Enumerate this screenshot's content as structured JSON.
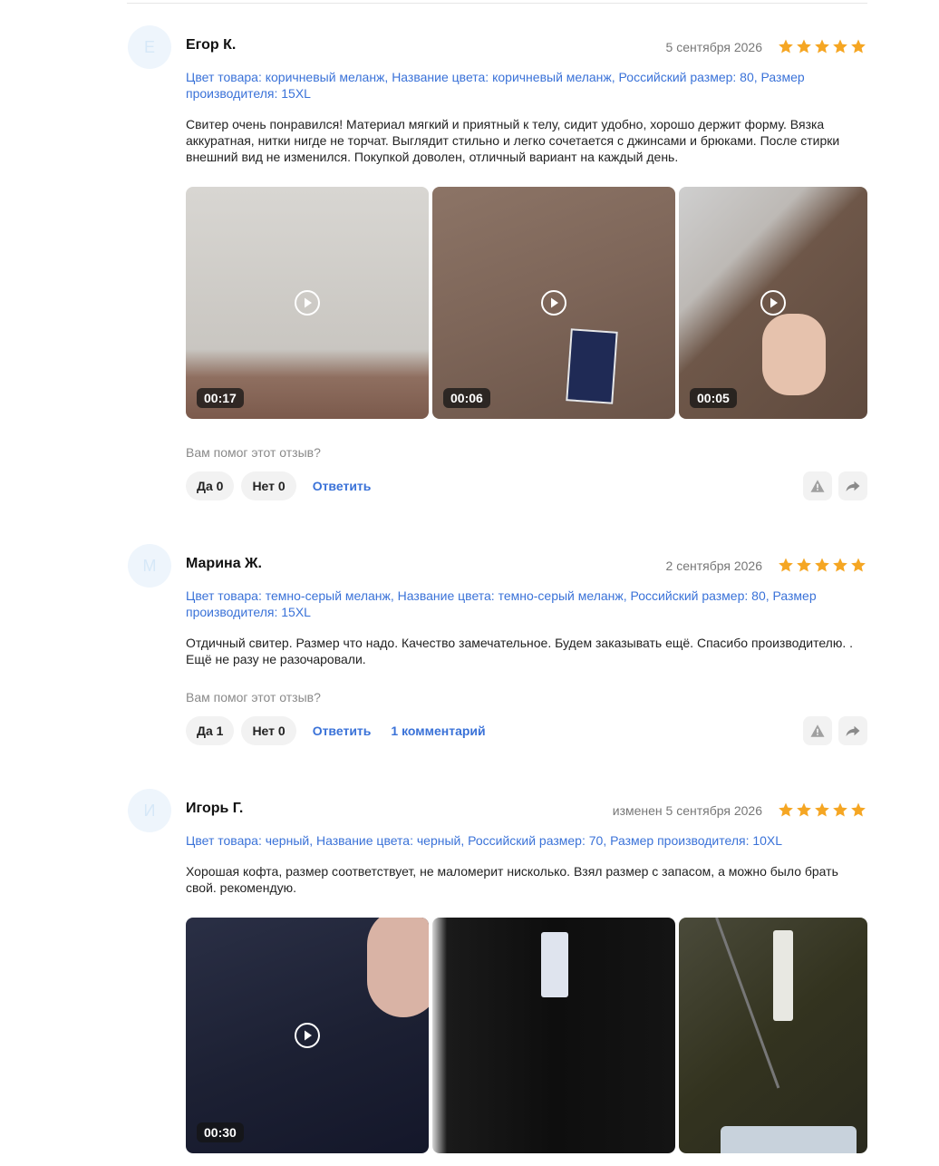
{
  "colors": {
    "accent": "#3a72d8",
    "star": "#f5a623"
  },
  "reviews": [
    {
      "initial": "Е",
      "author": "Егор К.",
      "date": "5 сентября 2026",
      "rating": 5,
      "attributes": "Цвет товара: коричневый меланж, Название цвета: коричневый меланж, Российский размер: 80, Размер производителя: 15XL",
      "text": "Свитер очень понравился! Материал мягкий и приятный к телу, сидит удобно, хорошо держит форму. Вязка аккуратная, нитки нигде не торчат. Выглядит стильно и легко сочетается с джинсами и брюками. После стирки внешний вид не изменился. Покупкой доволен, отличный вариант на каждый день.",
      "media": [
        {
          "type": "video",
          "duration": "00:17"
        },
        {
          "type": "video",
          "duration": "00:06"
        },
        {
          "type": "video",
          "duration": "00:05"
        }
      ],
      "helpful_question": "Вам помог этот отзыв?",
      "yes_label": "Да 0",
      "no_label": "Нет 0",
      "reply_label": "Ответить"
    },
    {
      "initial": "М",
      "author": "Марина Ж.",
      "date": "2 сентября 2026",
      "rating": 5,
      "attributes": "Цвет товара: темно-серый меланж, Название цвета: темно-серый меланж, Российский размер: 80, Размер производителя: 15XL",
      "text": "Отдичный свитер. Размер что надо. Качество замечательное. Будем заказывать ещё. Спасибо производителю. . Ещё не разу не разочаровали.",
      "helpful_question": "Вам помог этот отзыв?",
      "yes_label": "Да 1",
      "no_label": "Нет 0",
      "reply_label": "Ответить",
      "comments_label": "1 комментарий"
    },
    {
      "initial": "И",
      "author": "Игорь Г.",
      "date": "изменен 5 сентября 2026",
      "rating": 5,
      "attributes": "Цвет товара: черный, Название цвета: черный, Российский размер: 70, Размер производителя: 10XL",
      "text": "Хорошая кофта, размер соответствует, не маломерит нисколько. Взял размер с запасом, а можно было брать свой. рекомендую.",
      "media": [
        {
          "type": "video",
          "duration": "00:30"
        },
        {
          "type": "photo"
        },
        {
          "type": "photo"
        }
      ]
    }
  ]
}
